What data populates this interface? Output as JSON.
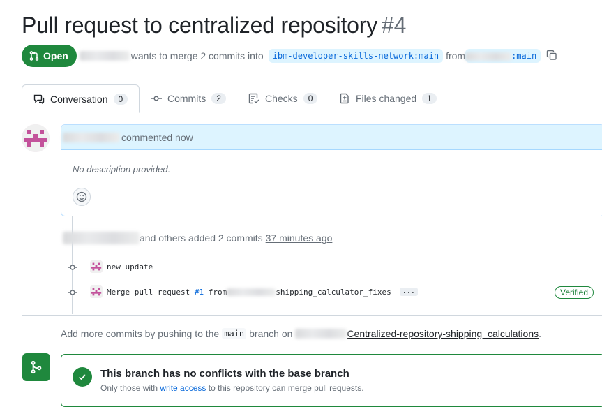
{
  "pr": {
    "title": "Pull request to centralized repository",
    "number": "#4",
    "status": "Open",
    "merge_text_prefix": "wants to merge 2 commits into",
    "base_branch": "ibm-developer-skills-network:main",
    "from_text": "from",
    "head_branch_suffix": ":main"
  },
  "tabs": [
    {
      "label": "Conversation",
      "count": "0",
      "icon": "comment-icon"
    },
    {
      "label": "Commits",
      "count": "2",
      "icon": "commit-icon"
    },
    {
      "label": "Checks",
      "count": "0",
      "icon": "checks-icon"
    },
    {
      "label": "Files changed",
      "count": "1",
      "icon": "file-diff-icon"
    }
  ],
  "comment": {
    "header_suffix": "commented now",
    "body": "No description provided."
  },
  "timeline": {
    "added_text": "and others added 2 commits",
    "time": "37 minutes ago",
    "commits": [
      {
        "message": "new update"
      },
      {
        "message_prefix": "Merge pull request",
        "pr_link": "#1",
        "from_text": "from",
        "branch_suffix": "shipping_calculator_fixes",
        "ellipsis": "...",
        "verified": "Verified"
      }
    ]
  },
  "push_hint": {
    "prefix": "Add more commits by pushing to the",
    "branch": "main",
    "middle": "branch on",
    "repo": "Centralized-repository-shipping_calculations",
    "suffix": "."
  },
  "merge": {
    "title": "This branch has no conflicts with the base branch",
    "sub_prefix": "Only those with",
    "sub_link": "write access",
    "sub_suffix": "to this repository can merge pull requests."
  },
  "colors": {
    "green": "#1f883d",
    "blue": "#0969da",
    "muted": "#656d76"
  }
}
